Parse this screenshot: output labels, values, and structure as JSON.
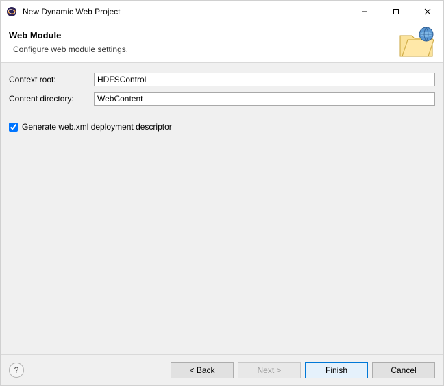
{
  "titlebar": {
    "title": "New Dynamic Web Project"
  },
  "banner": {
    "heading": "Web Module",
    "subheading": "Configure web module settings."
  },
  "form": {
    "context_root_label": "Context root:",
    "context_root_value": "HDFSControl",
    "content_dir_label": "Content directory:",
    "content_dir_value": "WebContent",
    "generate_webxml_label": "Generate web.xml deployment descriptor",
    "generate_webxml_checked": true
  },
  "buttons": {
    "back": "< Back",
    "next": "Next >",
    "finish": "Finish",
    "cancel": "Cancel"
  }
}
